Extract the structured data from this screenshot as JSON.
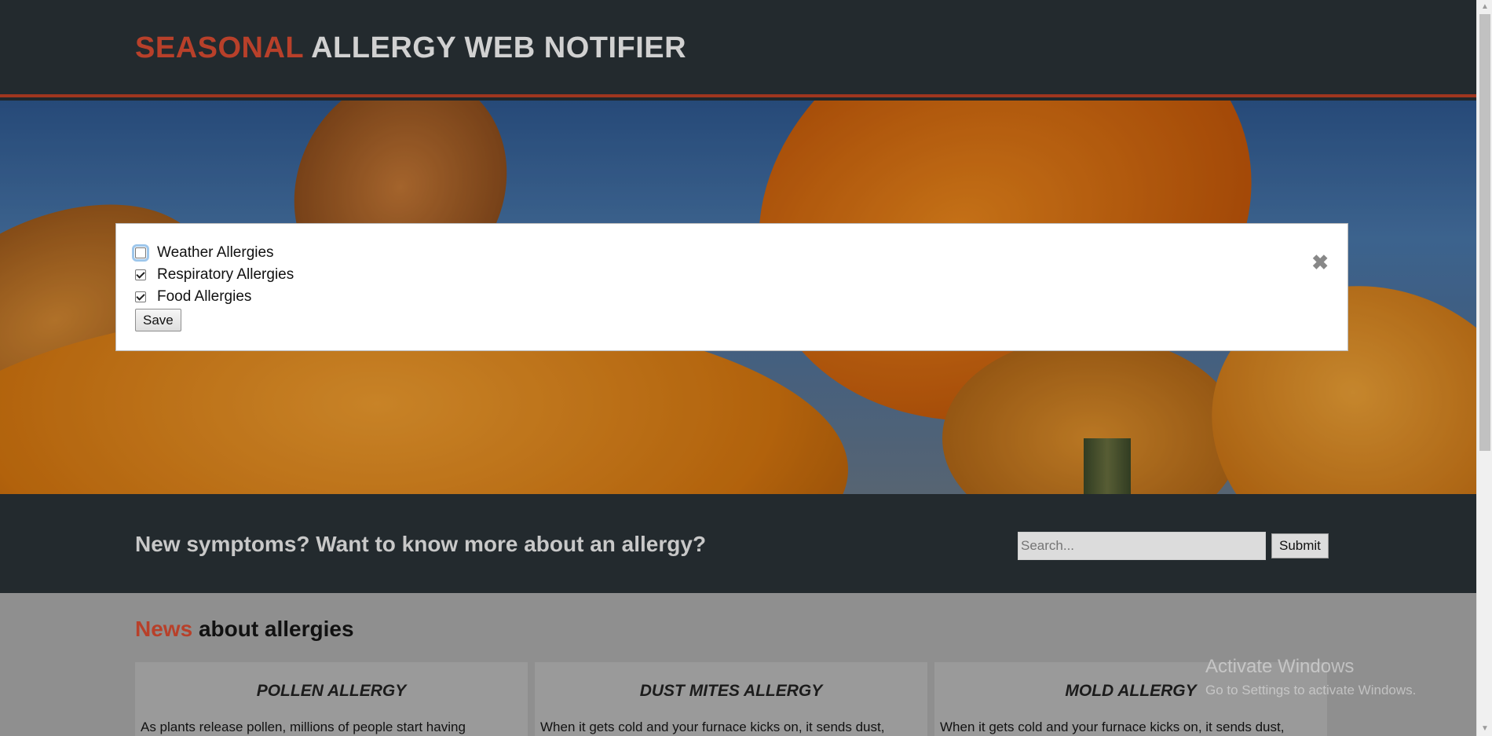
{
  "header": {
    "logo_accent": "SEASONAL",
    "logo_rest": "ALLERGY WEB NOTIFIER"
  },
  "modal": {
    "options": [
      {
        "label": "Weather Allergies",
        "checked": false
      },
      {
        "label": "Respiratory Allergies",
        "checked": true
      },
      {
        "label": "Food Allergies",
        "checked": true
      }
    ],
    "save_label": "Save",
    "close_glyph": "✖"
  },
  "band": {
    "text": "New symptoms? Want to know more about an allergy?",
    "search_placeholder": "Search...",
    "submit_label": "Submit"
  },
  "news": {
    "title_accent": "News",
    "title_rest": "about allergies",
    "cards": [
      {
        "title": "POLLEN ALLERGY",
        "text": "As plants release pollen, millions of people start having"
      },
      {
        "title": "DUST MITES ALLERGY",
        "text": "When it gets cold and your furnace kicks on, it sends dust,"
      },
      {
        "title": "MOLD ALLERGY",
        "text": "When it gets cold and your furnace kicks on, it sends dust,"
      }
    ]
  },
  "watermark": {
    "line1": "Activate Windows",
    "line2": "Go to Settings to activate Windows."
  },
  "colors": {
    "accent": "#b8402a",
    "header_bg": "#232a2e",
    "news_bg": "#8f8f8f"
  }
}
